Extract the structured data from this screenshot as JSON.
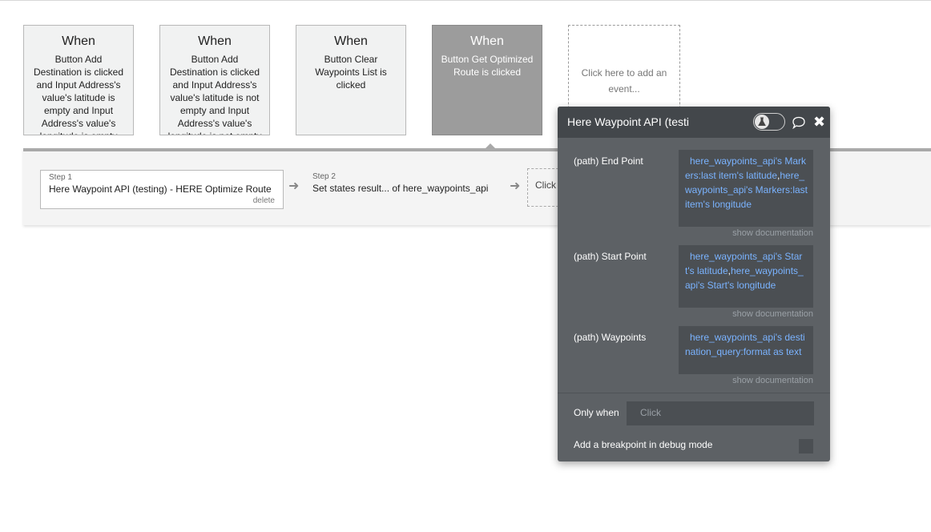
{
  "events": [
    {
      "when": "When",
      "description": "Button Add Destination is clicked and Input Address's value's latitude is empty and Input Address's value's longitude is empty"
    },
    {
      "when": "When",
      "description": "Button Add Destination is clicked and Input Address's value's latitude is not empty and Input Address's value's longitude is not empty"
    },
    {
      "when": "When",
      "description": "Button Clear Waypoints List is clicked"
    },
    {
      "when": "When",
      "description": "Button Get Optimized Route is clicked"
    }
  ],
  "add_event_label": "Click here to add an event...",
  "workflow": {
    "step1": {
      "num": "Step 1",
      "title": "Here Waypoint API (testing) - HERE Optimize Route",
      "delete": "delete"
    },
    "step2": {
      "num": "Step 2",
      "title": "Set states result... of here_waypoints_api"
    },
    "add_step_label": "Click"
  },
  "panel": {
    "title": "Here Waypoint API (testi",
    "fields": [
      {
        "label": "(path) End Point",
        "parts": [
          "here_waypoints_api's Markers:last item's latitude",
          ",",
          "here_waypoints_api's Markers:last item's longitude"
        ]
      },
      {
        "label": "(path) Start Point",
        "parts": [
          "here_waypoints_api's Start's latitude",
          ",",
          "here_waypoints_api's Start's longitude"
        ]
      },
      {
        "label": "(path) Waypoints",
        "parts": [
          "here_waypoints_api's destination_query:format as text"
        ]
      }
    ],
    "show_doc": "show documentation",
    "only_when_label": "Only when",
    "only_when_placeholder": "Click",
    "breakpoint_label": "Add a breakpoint in debug mode"
  },
  "colors": {
    "accent_link": "#7ab3ff",
    "panel_bg": "#5d6165",
    "panel_header": "#43474b",
    "active_event": "#9c9c9c"
  },
  "icons": [
    "flask-icon",
    "comment-icon",
    "close-icon",
    "arrow-right-icon"
  ]
}
